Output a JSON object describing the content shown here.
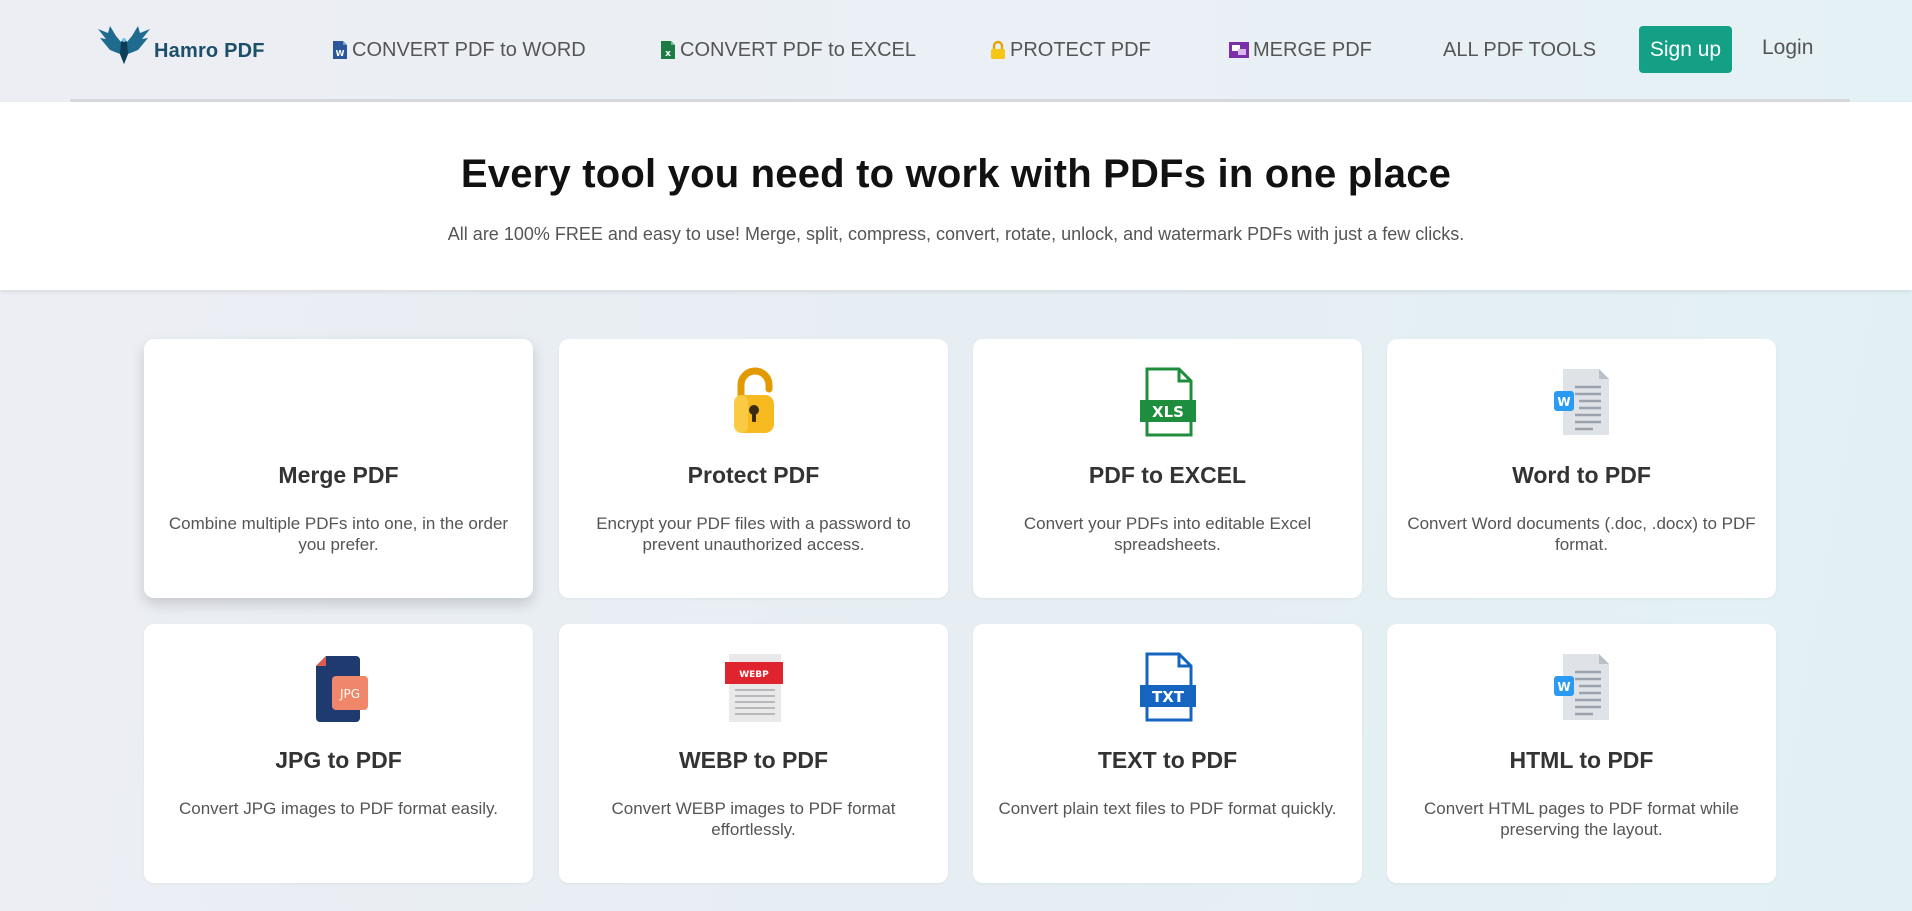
{
  "brand": {
    "name": "Hamro PDF"
  },
  "nav": {
    "items": [
      {
        "label": "CONVERT PDF to WORD",
        "icon": "word-file-icon"
      },
      {
        "label": "CONVERT PDF to EXCEL",
        "icon": "excel-file-icon"
      },
      {
        "label": "PROTECT PDF",
        "icon": "lock-icon"
      },
      {
        "label": "MERGE PDF",
        "icon": "merge-icon"
      },
      {
        "label": "ALL PDF TOOLS"
      }
    ],
    "signup_label": "Sign up",
    "login_label": "Login"
  },
  "hero": {
    "title": "Every tool you need to work with PDFs in one place",
    "subtitle": "All are 100% FREE and easy to use! Merge, split, compress, convert, rotate, unlock, and watermark PDFs with just a few clicks."
  },
  "tools": [
    {
      "title": "Merge PDF",
      "desc": "Combine multiple PDFs into one, in the order you prefer.",
      "icon": "none"
    },
    {
      "title": "Protect PDF",
      "desc": "Encrypt your PDF files with a password to prevent unauthorized access.",
      "icon": "padlock-icon"
    },
    {
      "title": "PDF to EXCEL",
      "desc": "Convert your PDFs into editable Excel spreadsheets.",
      "icon": "xls-file-icon",
      "icon_text": "XLS"
    },
    {
      "title": "Word to PDF",
      "desc": "Convert Word documents (.doc, .docx) to PDF format.",
      "icon": "word-document-icon",
      "icon_text": "W"
    },
    {
      "title": "JPG to PDF",
      "desc": "Convert JPG images to PDF format easily.",
      "icon": "jpg-file-icon",
      "icon_text": "JPG"
    },
    {
      "title": "WEBP to PDF",
      "desc": "Convert WEBP images to PDF format effortlessly.",
      "icon": "webp-file-icon",
      "icon_text": "WEBP"
    },
    {
      "title": "TEXT to PDF",
      "desc": "Convert plain text files to PDF format quickly.",
      "icon": "txt-file-icon",
      "icon_text": "TXT"
    },
    {
      "title": "HTML to PDF",
      "desc": "Convert HTML pages to PDF format while preserving the layout.",
      "icon": "word-document-icon",
      "icon_text": "W"
    }
  ],
  "colors": {
    "accent": "#14a085",
    "brand": "#1d4f6b",
    "excel_green": "#1e8e3e",
    "word_blue": "#2b7cd3",
    "txt_blue": "#1565c0",
    "webp_red": "#e0242f",
    "jpg_navy": "#1f3a6e",
    "jpg_orange": "#f0876a",
    "lock_gold": "#f2b01e",
    "merge_purple": "#7b2fa8"
  }
}
